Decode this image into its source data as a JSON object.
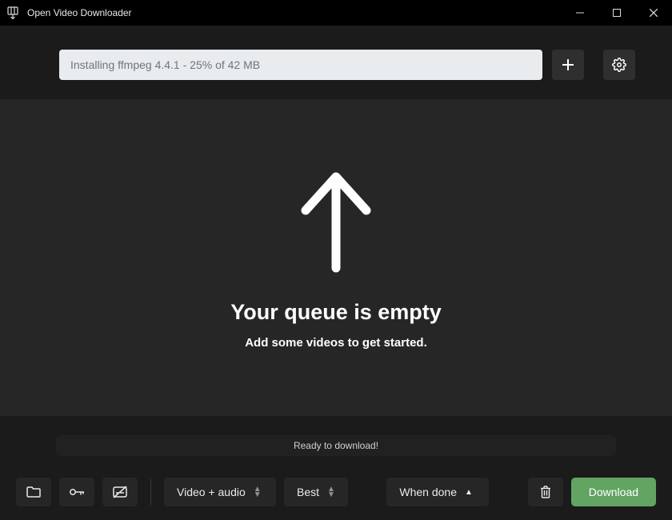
{
  "titlebar": {
    "title": "Open Video Downloader"
  },
  "topbar": {
    "placeholder": "Installing ffmpeg 4.4.1 - 25% of 42 MB"
  },
  "main": {
    "queue_title": "Your queue is empty",
    "queue_sub": "Add some videos to get started."
  },
  "status": {
    "text": "Ready to download!"
  },
  "bottombar": {
    "format_label": "Video + audio",
    "quality_label": "Best",
    "when_done_label": "When done",
    "download_label": "Download"
  }
}
